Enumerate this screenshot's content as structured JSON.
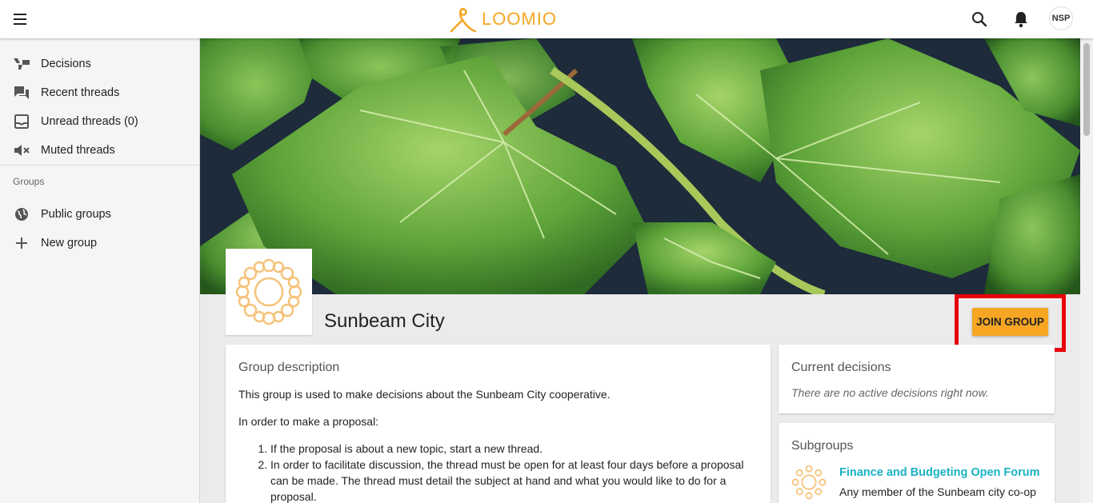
{
  "topbar": {
    "menu_icon": "hamburger-menu-icon",
    "logo_text": "LOOMIO",
    "search_icon": "search-icon",
    "notifications_icon": "bell-icon",
    "avatar_initials": "NSP"
  },
  "sidebar": {
    "items": [
      {
        "label": "Decisions",
        "icon": "thumbs-icon"
      },
      {
        "label": "Recent threads",
        "icon": "chat-icon"
      },
      {
        "label": "Unread threads (0)",
        "icon": "inbox-icon"
      },
      {
        "label": "Muted threads",
        "icon": "mute-icon"
      }
    ],
    "groups_heading": "Groups",
    "group_items": [
      {
        "label": "Public groups",
        "icon": "globe-icon"
      },
      {
        "label": "New group",
        "icon": "plus-icon"
      }
    ]
  },
  "group": {
    "name": "Sunbeam City",
    "join_label": "JOIN GROUP"
  },
  "description": {
    "title": "Group description",
    "intro": "This group is used to make decisions about the Sunbeam City cooperative.",
    "lead": "In order to make a proposal:",
    "steps": [
      "If the proposal is about a new topic, start a new thread.",
      "In order to facilitate discussion, the thread must be open for at least four days before a proposal can be made. The thread must detail the subject at hand and what you would like to do for a proposal."
    ]
  },
  "decisions": {
    "title": "Current decisions",
    "empty": "There are no active decisions right now."
  },
  "subgroups": {
    "title": "Subgroups",
    "items": [
      {
        "name": "Finance and Budgeting Open Forum",
        "description": "Any member of the Sunbeam city co-op can join this subgroup, ask general"
      }
    ]
  },
  "colors": {
    "accent": "#f6a623",
    "link": "#1ab2c5",
    "highlight": "#e8000b"
  }
}
